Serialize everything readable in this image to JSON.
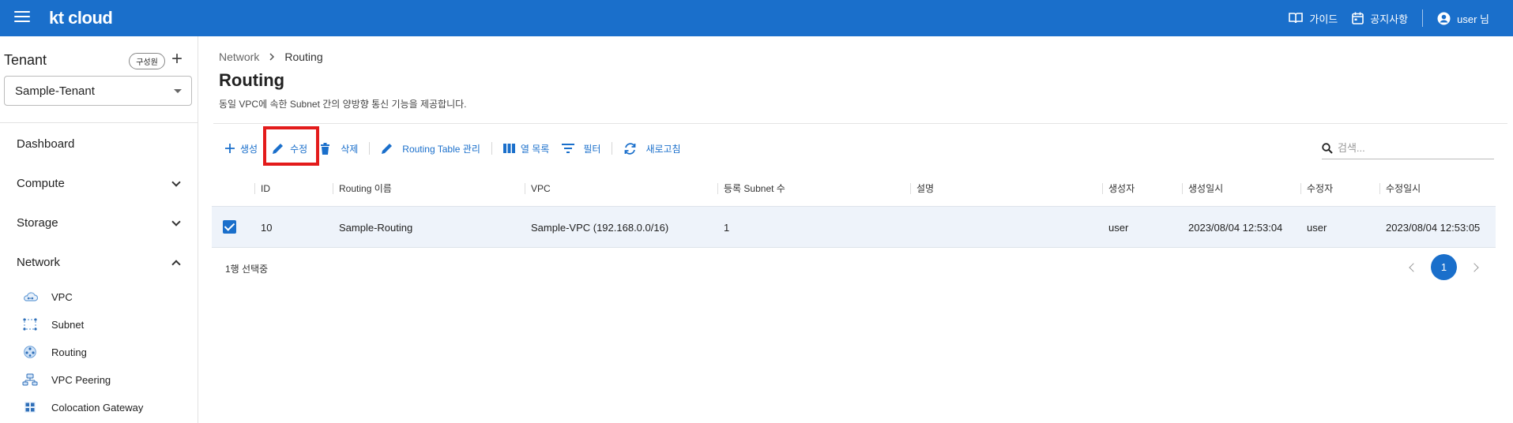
{
  "header": {
    "logo": "kt cloud",
    "guide_label": "가이드",
    "notice_label": "공지사항",
    "user_label": "user 님"
  },
  "sidebar": {
    "tenant_title": "Tenant",
    "member_label": "구성원",
    "tenant_value": "Sample-Tenant",
    "nav": [
      {
        "label": "Dashboard"
      },
      {
        "label": "Compute"
      },
      {
        "label": "Storage"
      },
      {
        "label": "Network"
      }
    ],
    "network_items": [
      {
        "label": "VPC",
        "icon": "vpc-icon"
      },
      {
        "label": "Subnet",
        "icon": "subnet-icon"
      },
      {
        "label": "Routing",
        "icon": "routing-icon"
      },
      {
        "label": "VPC Peering",
        "icon": "vpc-peering-icon"
      },
      {
        "label": "Colocation Gateway",
        "icon": "colocation-gateway-icon"
      }
    ]
  },
  "main": {
    "breadcrumb": [
      "Network",
      "Routing"
    ],
    "title": "Routing",
    "description": "동일 VPC에 속한 Subnet 간의 양방향 통신 기능을 제공합니다.",
    "toolbar": {
      "create": "생성",
      "edit": "수정",
      "delete": "삭제",
      "routing_table": "Routing Table 관리",
      "columns": "열 목록",
      "filter": "필터",
      "refresh": "새로고침"
    },
    "search_placeholder": "검색...",
    "table": {
      "columns": [
        "ID",
        "Routing 이름",
        "VPC",
        "등록 Subnet 수",
        "설명",
        "생성자",
        "생성일시",
        "수정자",
        "수정일시"
      ],
      "rows": [
        [
          "10",
          "Sample-Routing",
          "Sample-VPC (192.168.0.0/16)",
          "1",
          "",
          "user",
          "2023/08/04 12:53:04",
          "user",
          "2023/08/04 12:53:05"
        ]
      ]
    },
    "selection_text": "1행 선택중",
    "current_page": "1"
  },
  "colors": {
    "brand": "#1a6fcb",
    "highlight": "#e31b1b",
    "selected_row": "#eef3fa"
  }
}
